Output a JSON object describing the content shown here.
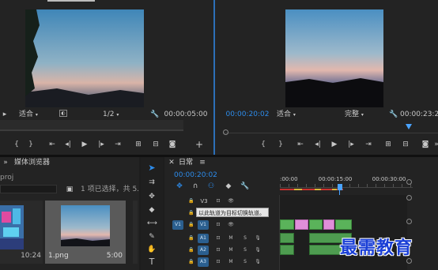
{
  "source_monitor": {
    "fit_label": "适合",
    "resolution": "1/2",
    "timecode_right": "00:00:05:00"
  },
  "program_monitor": {
    "timecode_left": "00:00:20:02",
    "fit_label": "适合",
    "quality": "完整",
    "timecode_right": "00:00:23:24"
  },
  "project_panel": {
    "tab_label": "媒体浏览器",
    "proj_label": "proj",
    "selection_status": "1 项已选择，共 5...",
    "thumb1_duration": "10:24",
    "thumb2_name": "1.png",
    "thumb2_duration": "5:00"
  },
  "timeline": {
    "tab_label": "日常",
    "timecode": "00:00:20:02",
    "ruler": [
      ":00:00",
      "00:00:15:00",
      "00:00:30:00"
    ],
    "tooltip": "以此轨道为目标切换轨道。",
    "tracks": [
      {
        "source": "",
        "name": "V3"
      },
      {
        "source": "",
        "name": "V2"
      },
      {
        "source": "V1",
        "name": "V1"
      },
      {
        "source": "",
        "name": "A1"
      },
      {
        "source": "",
        "name": "A2"
      },
      {
        "source": "",
        "name": "A3"
      }
    ],
    "track_m": "M",
    "track_s": "S"
  },
  "watermark": "最需教育",
  "colors": {
    "accent_blue": "#2d8ceb",
    "clip_pink": "#e08fd9",
    "clip_green": "#5ab35a",
    "playhead": "#4aa3ff"
  }
}
